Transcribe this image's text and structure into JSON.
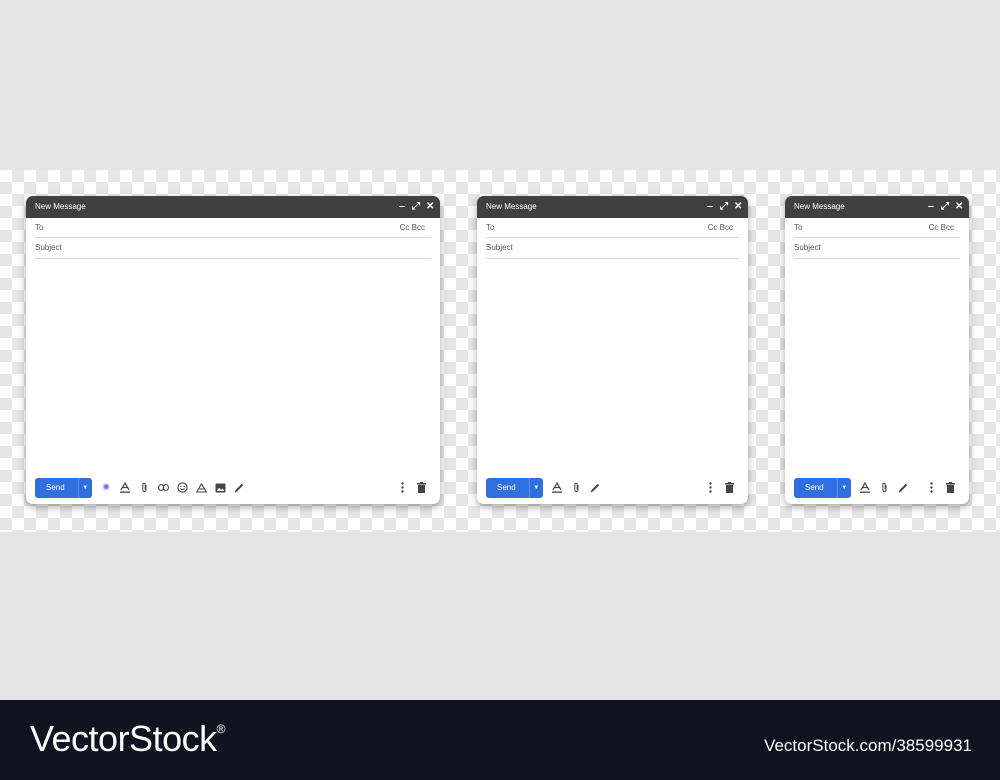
{
  "windows": [
    {
      "title": "New Message",
      "to_label": "To",
      "ccbcc_label": "Cc Bcc",
      "subject_label": "Subject",
      "send_label": "Send",
      "tools": [
        "sparkle-icon",
        "format-text-icon",
        "attach-icon",
        "link-icon",
        "emoji-icon",
        "drive-icon",
        "image-icon",
        "signature-pen-icon"
      ]
    },
    {
      "title": "New Message",
      "to_label": "To",
      "ccbcc_label": "Cc Bcc",
      "subject_label": "Subject",
      "send_label": "Send",
      "tools": [
        "format-text-icon",
        "attach-icon",
        "signature-pen-icon"
      ]
    },
    {
      "title": "New Message",
      "to_label": "To",
      "ccbcc_label": "Cc Bcc",
      "subject_label": "Subject",
      "send_label": "Send",
      "tools": [
        "format-text-icon",
        "attach-icon",
        "signature-pen-icon"
      ]
    }
  ],
  "window_controls": [
    "minimize-icon",
    "expand-icon",
    "close-icon"
  ],
  "footer_right": [
    "more-options-icon",
    "trash-icon"
  ],
  "colors": {
    "send": "#2f6fdf",
    "titlebar": "#404040"
  },
  "watermark": {
    "brand": "VectorStock",
    "registered": "®",
    "stock_id": "VectorStock.com/38599931"
  }
}
